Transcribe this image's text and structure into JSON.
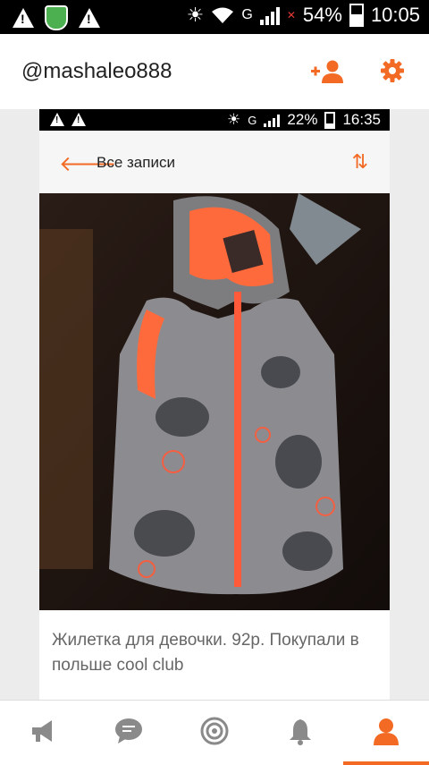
{
  "status_bar": {
    "battery": "54%",
    "time": "10:05",
    "network": "G"
  },
  "profile_header": {
    "username": "@mashaleo888",
    "add_friend_icon": "add-person-icon",
    "settings_icon": "gear-icon",
    "accent": "#f26a24"
  },
  "inner_screenshot": {
    "status_bar": {
      "battery": "22%",
      "time": "16:35",
      "network": "G"
    },
    "nav": {
      "back_icon": "arrow-left-icon",
      "title": "Все записи",
      "sort_icon": "sort-arrows-icon"
    },
    "photo": {
      "subject": "Orange-lined grey vest with cat print and hood"
    },
    "caption": "Жилетка для девочки. 92р. Покупали в польше cool club"
  },
  "bottom_nav": {
    "items": [
      {
        "icon": "megaphone-icon"
      },
      {
        "icon": "chat-icon"
      },
      {
        "icon": "target-icon"
      },
      {
        "icon": "bell-icon"
      },
      {
        "icon": "person-icon",
        "active": true
      }
    ]
  }
}
